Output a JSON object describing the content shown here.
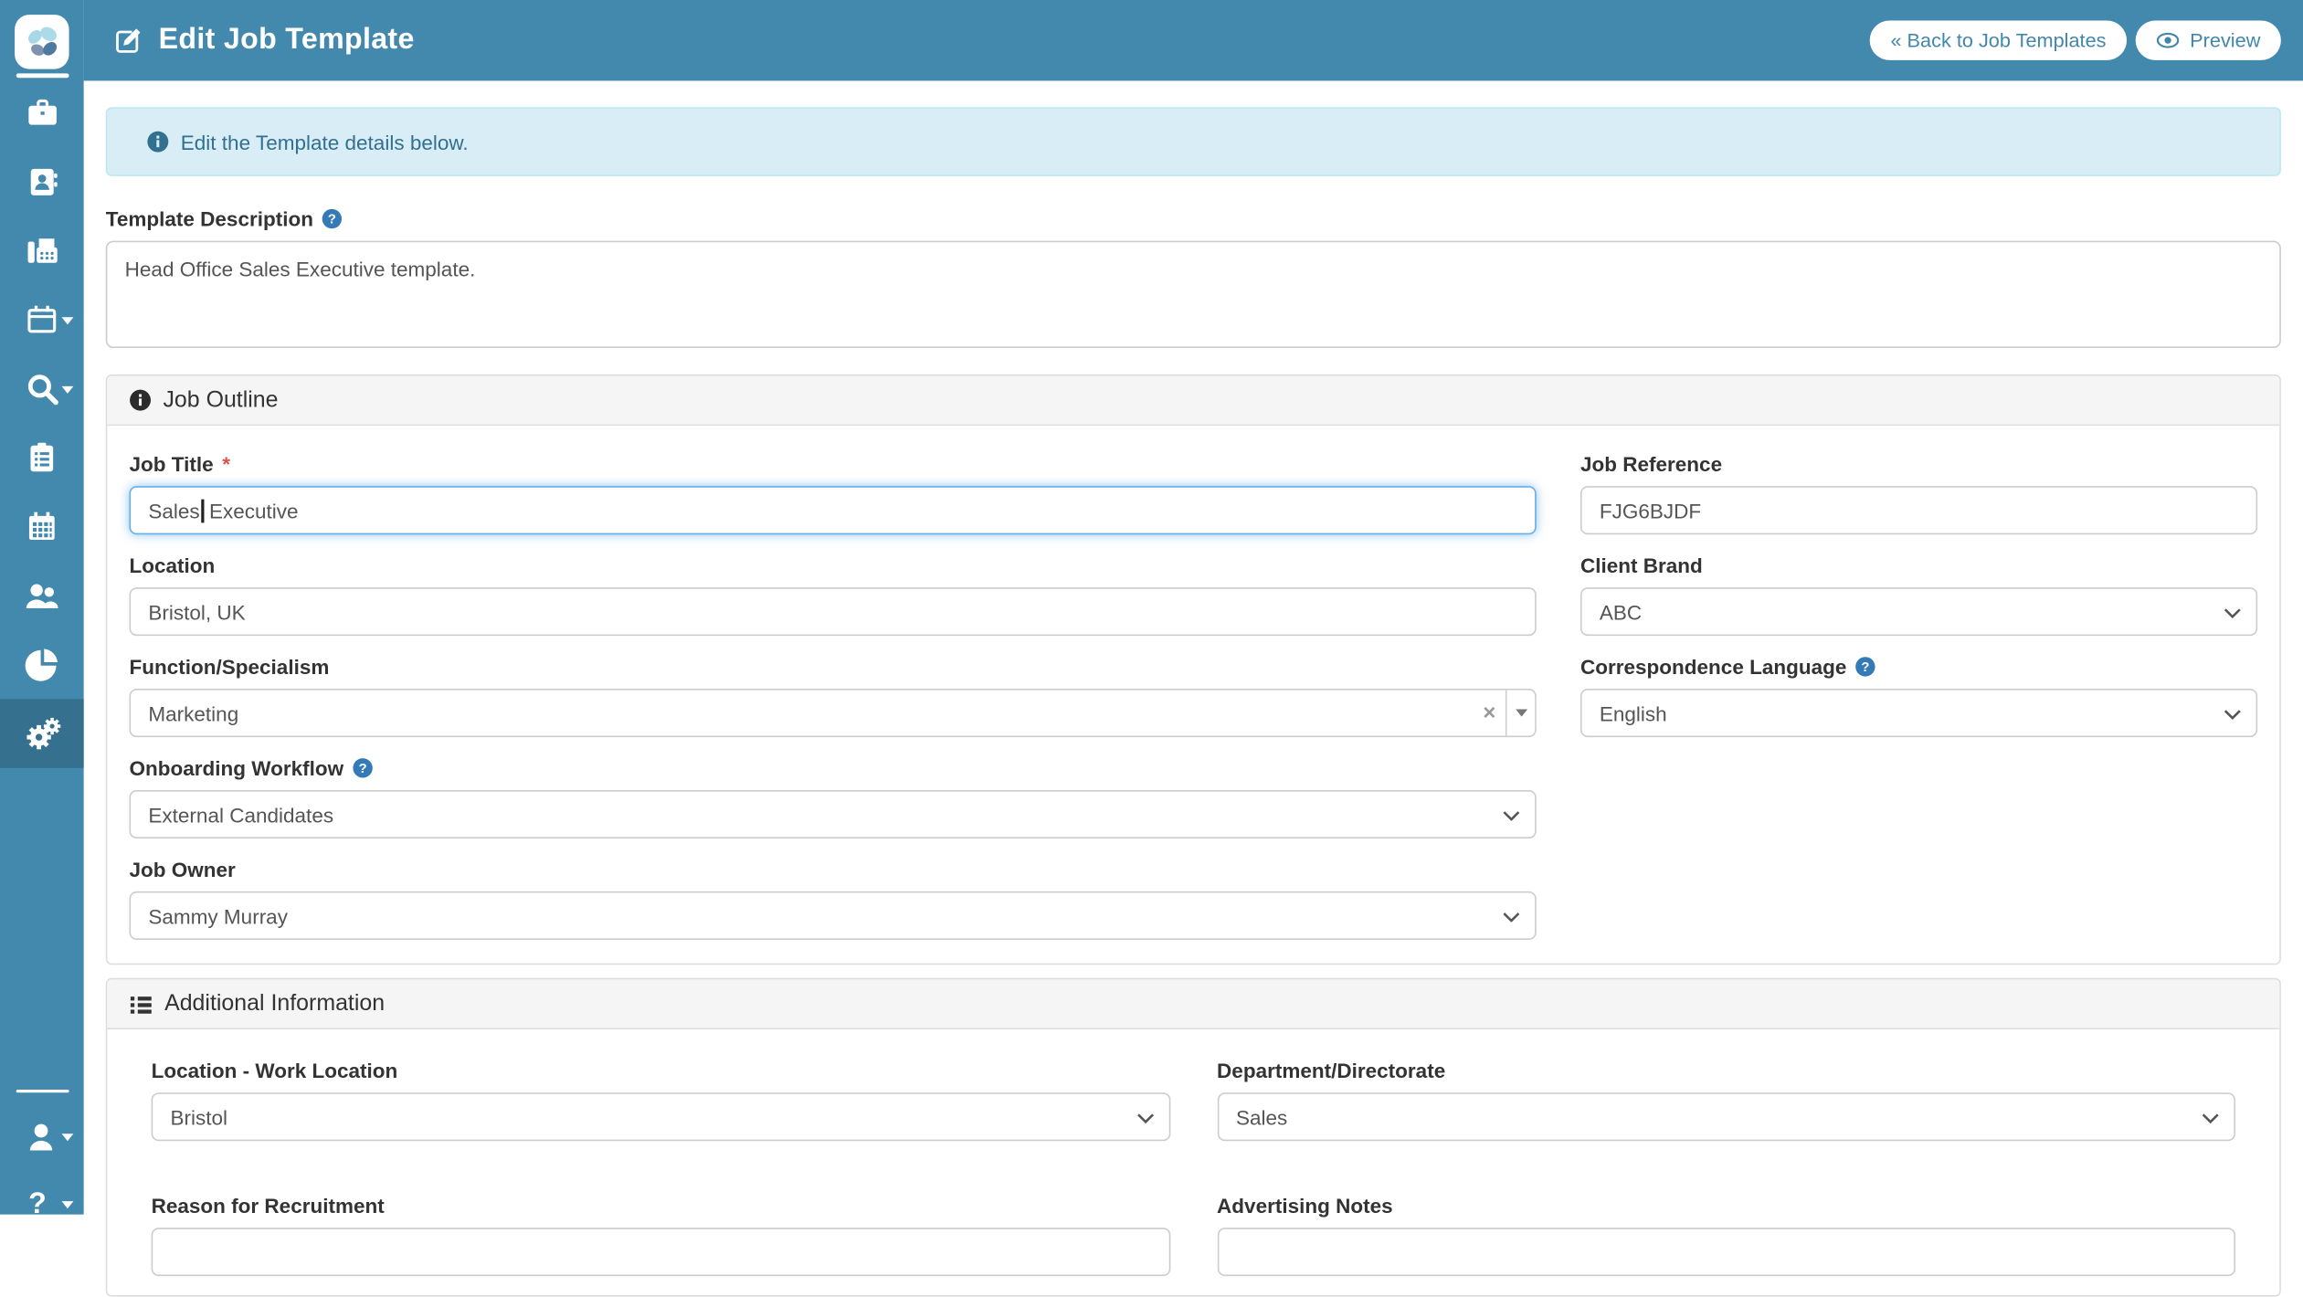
{
  "colors": {
    "header_blue": "#4289ad",
    "sidebar_active_blue": "#35718f",
    "alert_bg": "#d9edf7",
    "alert_text": "#31708f",
    "help_icon_blue": "#337ab7",
    "focus_border": "#66afe9",
    "required_red": "#d9534f"
  },
  "sidebar": {
    "icons": [
      "butterfly-logo",
      "briefcase",
      "address-book",
      "fax",
      "calendar-dropdown",
      "search-dropdown",
      "clipboard-list",
      "calendar-grid",
      "users",
      "pie-chart",
      "gears",
      "user-dropdown",
      "help-dropdown"
    ],
    "help_glyph": "?"
  },
  "header": {
    "title": "Edit Job Template",
    "back_button_label": "« Back to Job Templates",
    "preview_button_label": "Preview"
  },
  "alert": {
    "message": "Edit the Template details below."
  },
  "description": {
    "label": "Template Description",
    "value": "Head Office Sales Executive template."
  },
  "job_outline": {
    "section_title": "Job Outline",
    "job_title": {
      "label": "Job Title",
      "required_mark": "*",
      "value_before_cursor": "Sales",
      "value_after_cursor": " Executive"
    },
    "job_reference": {
      "label": "Job Reference",
      "value": "FJG6BJDF"
    },
    "location": {
      "label": "Location",
      "value": "Bristol, UK"
    },
    "client_brand": {
      "label": "Client Brand",
      "value": "ABC"
    },
    "function_specialism": {
      "label": "Function/Specialism",
      "value": "Marketing",
      "clear_glyph": "×"
    },
    "correspondence_language": {
      "label": "Correspondence Language",
      "value": "English"
    },
    "onboarding_workflow": {
      "label": "Onboarding Workflow",
      "value": "External Candidates"
    },
    "job_owner": {
      "label": "Job Owner",
      "value": "Sammy Murray"
    }
  },
  "additional_information": {
    "section_title": "Additional Information",
    "work_location": {
      "label": "Location - Work Location",
      "value": "Bristol"
    },
    "department": {
      "label": "Department/Directorate",
      "value": "Sales"
    },
    "reason_for_recruitment": {
      "label": "Reason for Recruitment",
      "value": ""
    },
    "advertising_notes": {
      "label": "Advertising Notes",
      "value": ""
    }
  }
}
